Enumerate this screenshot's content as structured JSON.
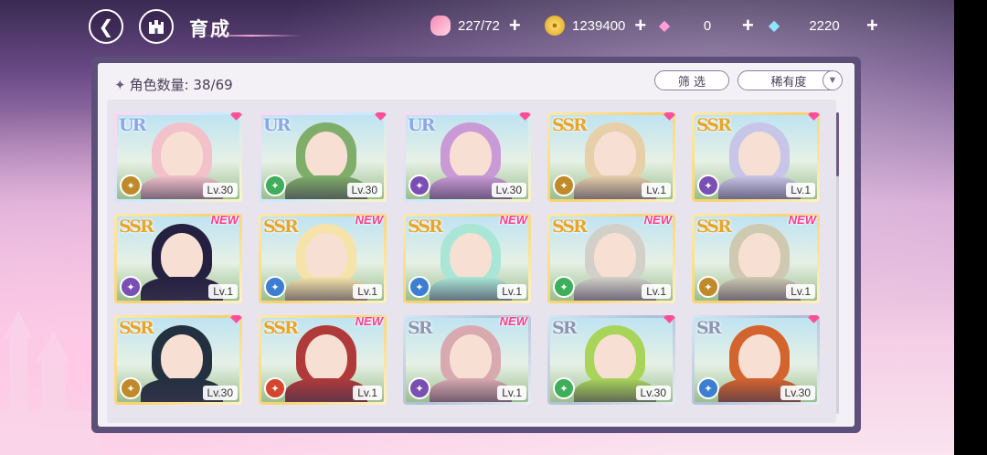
{
  "header": {
    "back_icon": "back-arrow-icon",
    "home_icon": "castle-home-icon",
    "title": "育成"
  },
  "resources": [
    {
      "name": "candy",
      "icon": "candy-icon",
      "value": "227/72"
    },
    {
      "name": "coin",
      "icon": "coin-icon",
      "value": "1239400"
    },
    {
      "name": "pink-gem",
      "icon": "pink-gem-icon",
      "value": "0"
    },
    {
      "name": "diamond",
      "icon": "diamond-icon",
      "value": "2220"
    }
  ],
  "panel": {
    "count_label": "角色数量",
    "count_value": "38/69",
    "filter_label": "筛 选",
    "rarity_label": "稀有度"
  },
  "cards": [
    {
      "rarity": "UR",
      "level": "Lv.30",
      "new": false,
      "element": "gold",
      "hair": "#f2c1c9",
      "elem_icon": "wand-icon"
    },
    {
      "rarity": "UR",
      "level": "Lv.30",
      "new": false,
      "element": "green",
      "hair": "#7fae6a",
      "elem_icon": "scroll-icon"
    },
    {
      "rarity": "UR",
      "level": "Lv.30",
      "new": false,
      "element": "purple",
      "hair": "#c99ad6",
      "elem_icon": "book-icon"
    },
    {
      "rarity": "SSR",
      "level": "Lv.1",
      "new": false,
      "element": "gold",
      "hair": "#e6cfa9",
      "elem_icon": "wand-icon"
    },
    {
      "rarity": "SSR",
      "level": "Lv.1",
      "new": false,
      "element": "purple",
      "hair": "#c8c6e8",
      "elem_icon": "fist-icon"
    },
    {
      "rarity": "SSR",
      "level": "Lv.1",
      "new": true,
      "element": "purple",
      "hair": "#252040",
      "elem_icon": "book-icon"
    },
    {
      "rarity": "SSR",
      "level": "Lv.1",
      "new": true,
      "element": "blue",
      "hair": "#f5e3a9",
      "elem_icon": "book-icon"
    },
    {
      "rarity": "SSR",
      "level": "Lv.1",
      "new": true,
      "element": "blue",
      "hair": "#a9e6d6",
      "elem_icon": "book-icon"
    },
    {
      "rarity": "SSR",
      "level": "Lv.1",
      "new": true,
      "element": "green",
      "hair": "#d2d0c8",
      "elem_icon": "wand-icon"
    },
    {
      "rarity": "SSR",
      "level": "Lv.1",
      "new": true,
      "element": "gold",
      "hair": "#cfc9b1",
      "elem_icon": "book-icon"
    },
    {
      "rarity": "SSR",
      "level": "Lv.30",
      "new": false,
      "element": "gold",
      "hair": "#23303f",
      "elem_icon": "book-icon"
    },
    {
      "rarity": "SSR",
      "level": "Lv.1",
      "new": true,
      "element": "red",
      "hair": "#b03a3a",
      "elem_icon": "book-icon"
    },
    {
      "rarity": "SR",
      "level": "Lv.1",
      "new": true,
      "element": "purple",
      "hair": "#d8a9ae",
      "elem_icon": "fist-icon"
    },
    {
      "rarity": "SR",
      "level": "Lv.30",
      "new": false,
      "element": "green",
      "hair": "#a9d45a",
      "elem_icon": "shield-icon"
    },
    {
      "rarity": "SR",
      "level": "Lv.30",
      "new": false,
      "element": "blue",
      "hair": "#d4642e",
      "elem_icon": "fist-icon"
    }
  ],
  "colors": {
    "gold": "#c08a2a",
    "green": "#3fae5a",
    "purple": "#7a4fb3",
    "blue": "#3c7fd0",
    "red": "#d6462f",
    "new_tag": "#ff3c8a"
  },
  "new_label": "NEW"
}
